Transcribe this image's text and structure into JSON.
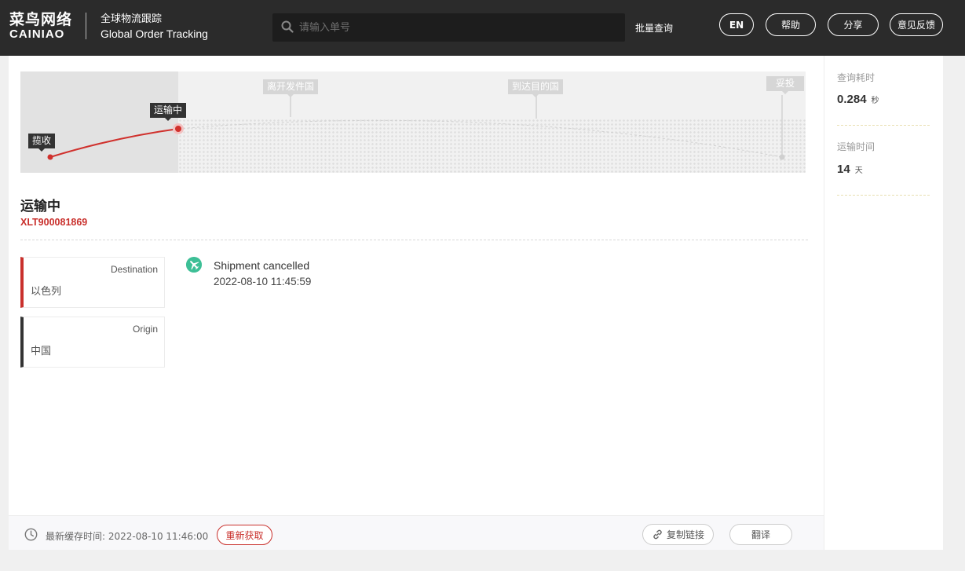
{
  "header": {
    "logo_cn": "菜鸟网络",
    "logo_en": "CAINIAO",
    "title_cn": "全球物流跟踪",
    "title_en": "Global Order Tracking",
    "search_placeholder": "请输入单号",
    "batch_query": "批量查询",
    "lang_button": "EN",
    "help_button": "帮助",
    "share_button": "分享",
    "feedback_button": "意见反馈"
  },
  "map": {
    "stages": {
      "pickup": "揽收",
      "in_transit": "运输中",
      "leave_origin": "离开发件国",
      "arrive_destination": "到达目的国",
      "delivered": "妥投"
    }
  },
  "shipment": {
    "status": "运输中",
    "tracking_number": "XLT900081869",
    "destination_label": "Destination",
    "destination_value": "以色列",
    "origin_label": "Origin",
    "origin_value": "中国"
  },
  "events": [
    {
      "title": "Shipment cancelled",
      "time": "2022-08-10 11:45:59",
      "icon": "airplane-icon"
    }
  ],
  "footer": {
    "cache_time": "最新缓存时间: 2022-08-10 11:46:00",
    "refresh_button": "重新获取",
    "copy_link_button": "复制链接",
    "translate_button": "翻译"
  },
  "sidebar": {
    "query_time_label": "查询耗时",
    "query_time_value": "0.284",
    "query_time_unit": "秒",
    "transit_time_label": "运输时间",
    "transit_time_value": "14",
    "transit_time_unit": "天"
  },
  "colors": {
    "header_bg": "#2b2b2b",
    "accent_red": "#c9302c",
    "event_green": "#3dbf96"
  }
}
